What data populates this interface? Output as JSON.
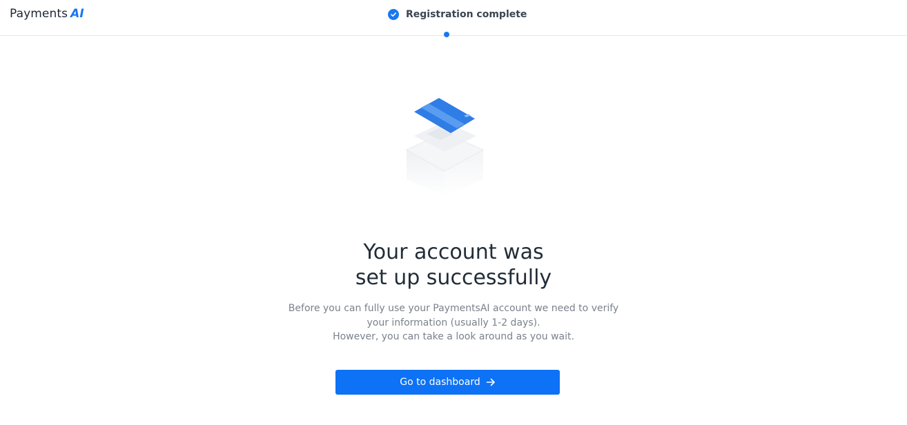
{
  "header": {
    "logo_text": "Payments",
    "logo_accent": "AI",
    "step_label": "Registration complete",
    "step_icon": "check-circle-icon"
  },
  "illustration": {
    "icon": "credit-card-box-illustration"
  },
  "main": {
    "title_line1": "Your account was",
    "title_line2": "set up successfully",
    "desc_line1": "Before you can fully use your PaymentsAI account we need to verify",
    "desc_line2": "your information (usually 1-2 days).",
    "desc_line3": "However, you can take a look around as you wait.",
    "cta_label": "Go to dashboard",
    "cta_icon": "arrow-right-icon"
  },
  "colors": {
    "accent": "#1877f2",
    "button": "#0d72f5",
    "title": "#222d38",
    "muted": "#7a818c"
  }
}
